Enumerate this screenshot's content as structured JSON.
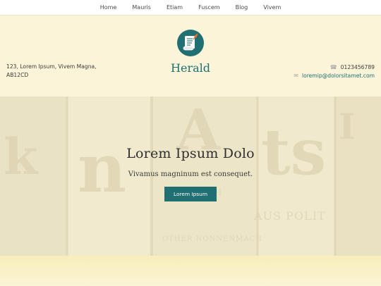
{
  "nav": {
    "items": [
      {
        "label": "Home"
      },
      {
        "label": "Mauris"
      },
      {
        "label": "Etiam"
      },
      {
        "label": "Fuscem"
      },
      {
        "label": "Blog"
      },
      {
        "label": "Vivem"
      }
    ]
  },
  "header": {
    "address_line1": "123, Lorem Ipsum, Vivem Magna,",
    "address_line2": "AB12CD",
    "brand_name": "Herald",
    "logo_icon": "newspaper-scroll-icon",
    "phone": "0123456789",
    "phone_icon": "phone-icon",
    "email": "loremip@dolorsitamet.com",
    "email_icon": "envelope-icon"
  },
  "hero": {
    "title": "Lorem Ipsum Dolo",
    "subtitle": "Vivamus magninum est consequet.",
    "button_label": "Lorem Ipsum",
    "background_image": "newspaper-rolls-photo"
  },
  "colors": {
    "accent": "#1f6f73",
    "background": "#fbf4d8"
  }
}
